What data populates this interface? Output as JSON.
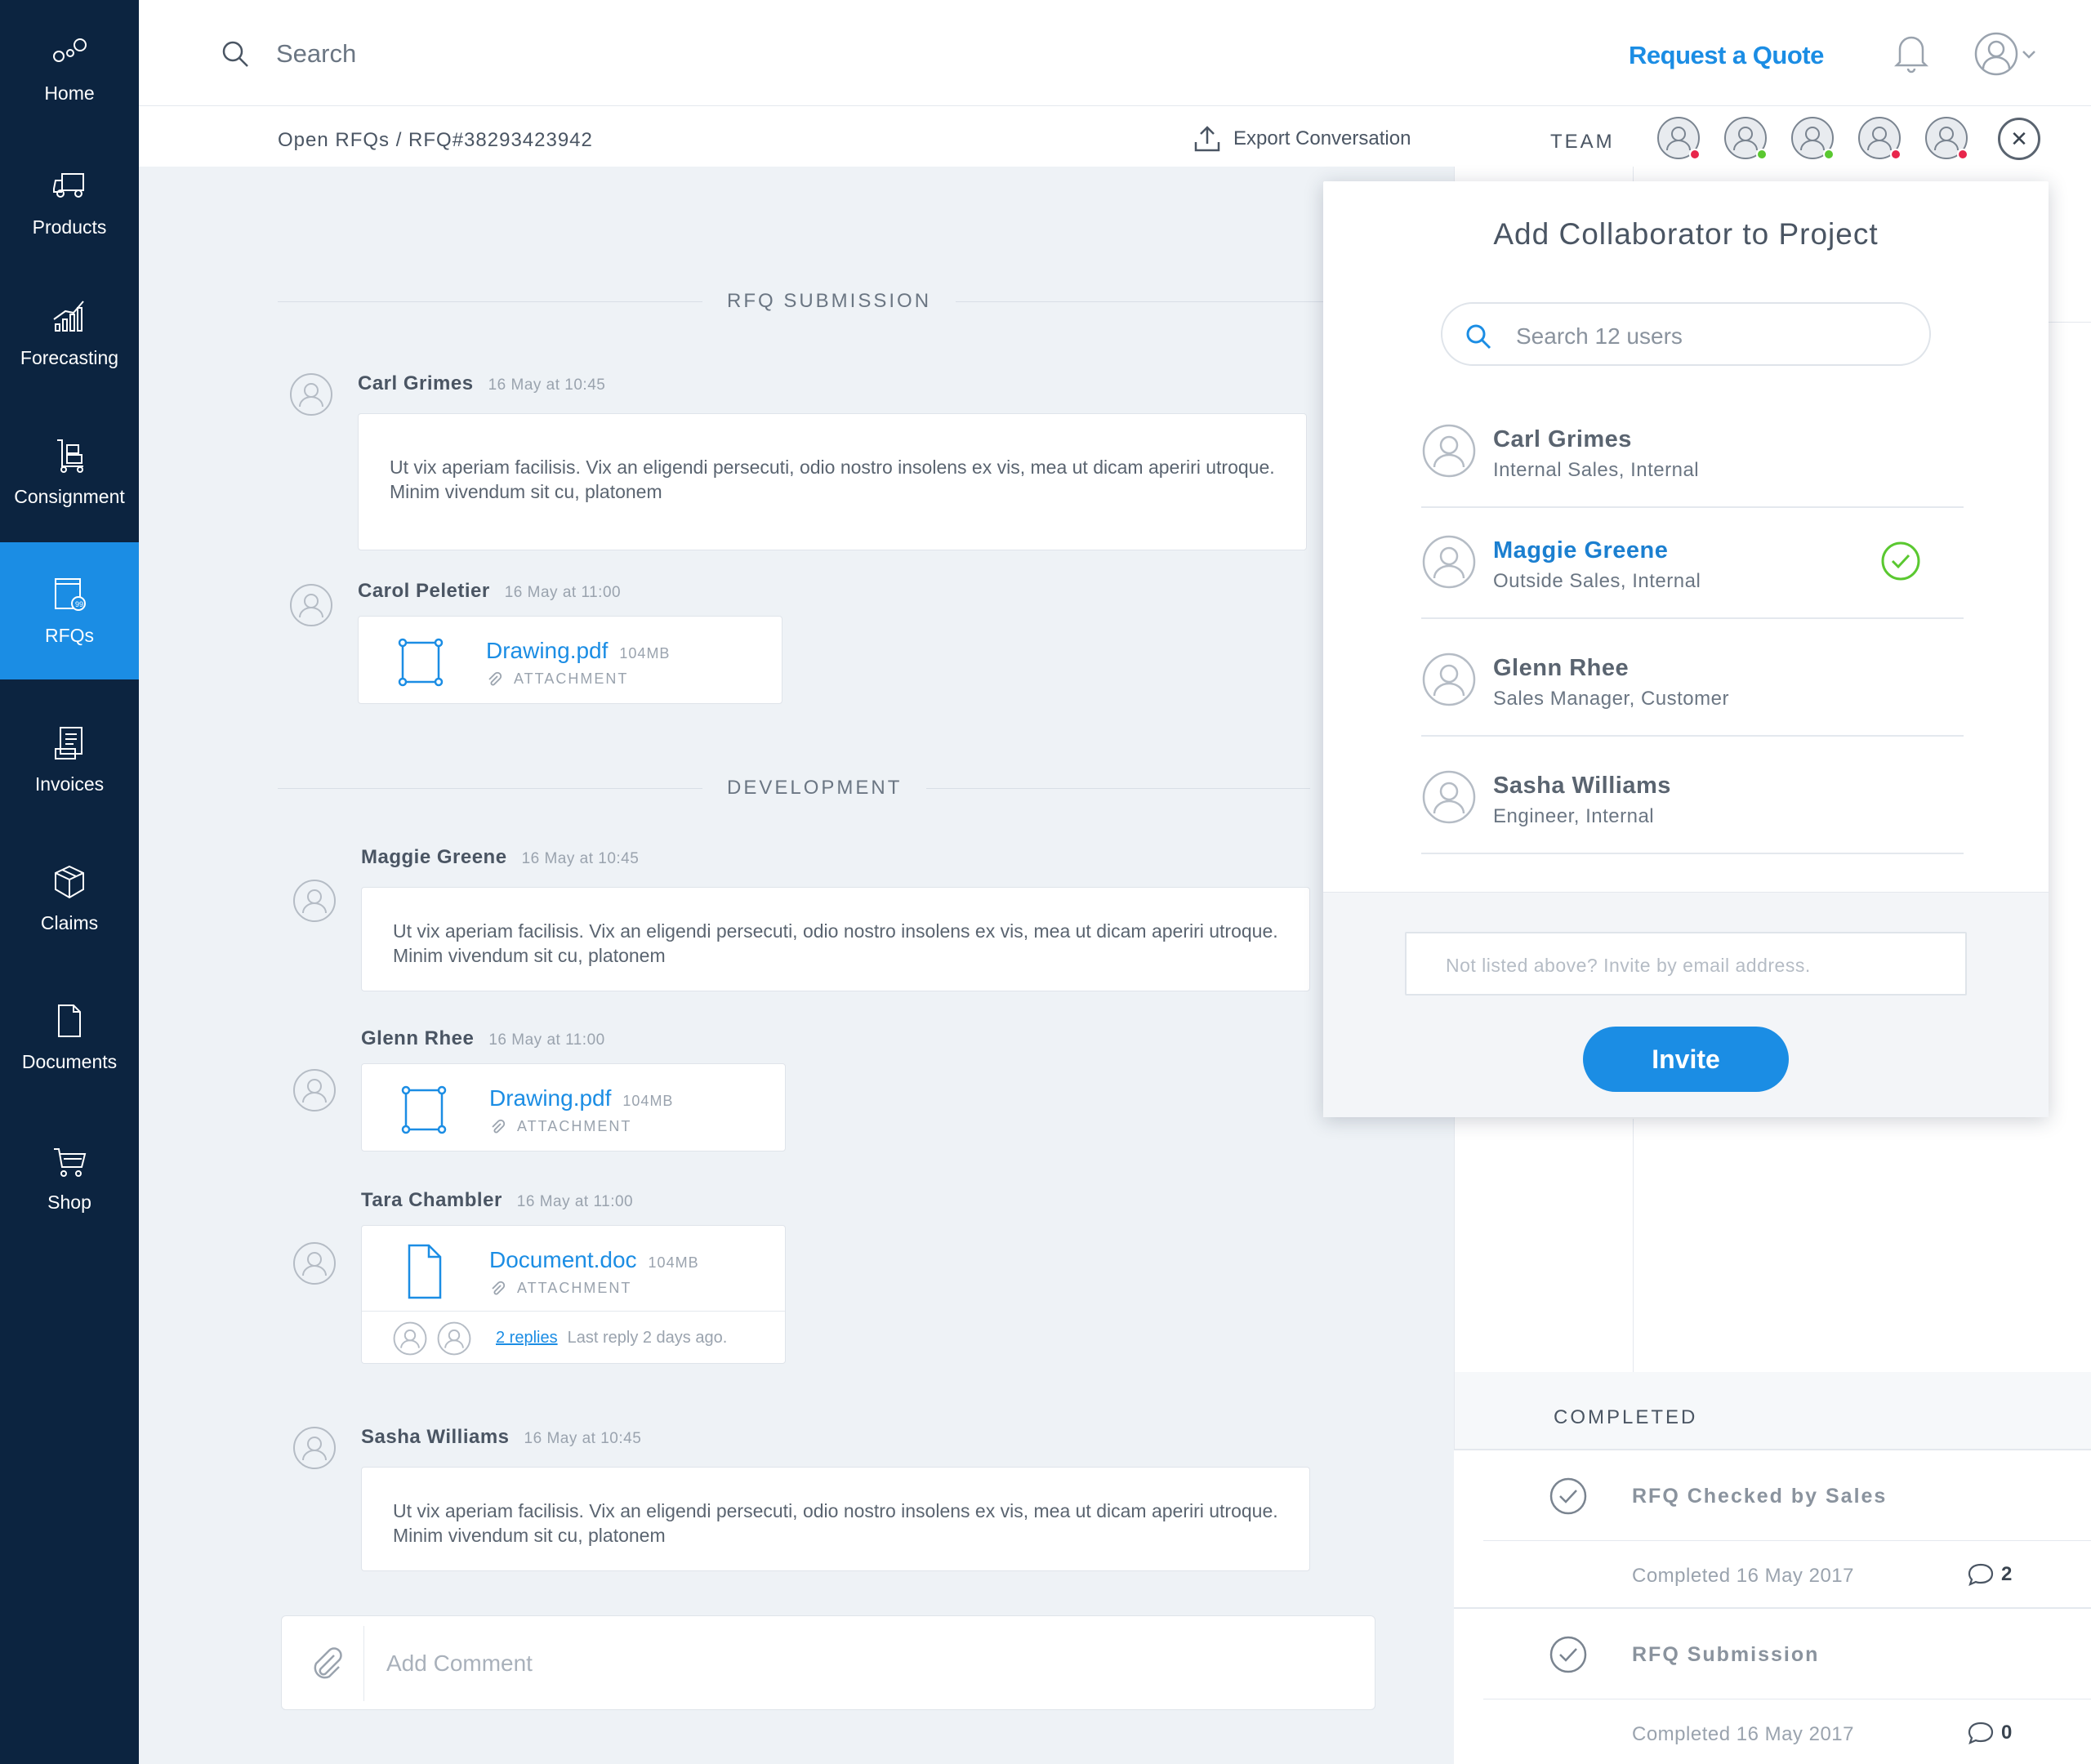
{
  "sidebar": {
    "items": [
      {
        "label": "Home",
        "icon": "home-icon"
      },
      {
        "label": "Products",
        "icon": "truck-icon"
      },
      {
        "label": "Forecasting",
        "icon": "chart-icon"
      },
      {
        "label": "Consignment",
        "icon": "cart-dolly-icon"
      },
      {
        "label": "RFQs",
        "icon": "rfq-icon",
        "active": true
      },
      {
        "label": "Invoices",
        "icon": "invoice-icon"
      },
      {
        "label": "Claims",
        "icon": "box-icon"
      },
      {
        "label": "Documents",
        "icon": "document-icon"
      },
      {
        "label": "Shop",
        "icon": "shop-cart-icon"
      }
    ]
  },
  "topbar": {
    "search_placeholder": "Search",
    "request_quote": "Request a Quote"
  },
  "subbar": {
    "breadcrumb": "Open RFQs / RFQ#38293423942",
    "export_label": "Export Conversation",
    "team_label": "TEAM",
    "team_status": [
      "red",
      "green",
      "green",
      "red",
      "red"
    ],
    "close_symbol": "✕"
  },
  "colors": {
    "accent": "#1b8de4",
    "sidebar_bg": "#0c2440",
    "status_red": "#e8264b",
    "status_green": "#5ac830",
    "check_green": "#5ac830"
  },
  "conversation": {
    "section1": "RFQ SUBMISSION",
    "section2": "DEVELOPMENT",
    "messages": [
      {
        "author": "Carl Grimes",
        "time": "16 May at 10:45",
        "text": "Ut vix aperiam facilisis. Vix an eligendi persecuti, odio nostro insolens ex vis, mea ut dicam aperiri utroque. Minim vivendum sit cu, platonem"
      },
      {
        "author": "Carol Peletier",
        "time": "16 May at 11:00",
        "file": "Drawing.pdf",
        "size": "104MB",
        "label": "ATTACHMENT"
      },
      {
        "author": "Maggie Greene",
        "time": "16 May at 10:45",
        "text": "Ut vix aperiam facilisis. Vix an eligendi persecuti, odio nostro insolens ex vis, mea ut dicam aperiri utroque. Minim vivendum sit cu, platonem"
      },
      {
        "author": "Glenn Rhee",
        "time": "16 May at 11:00",
        "file": "Drawing.pdf",
        "size": "104MB",
        "label": "ATTACHMENT"
      },
      {
        "author": "Tara Chambler",
        "time": "16 May at 11:00",
        "file": "Document.doc",
        "size": "104MB",
        "label": "ATTACHMENT",
        "replies": "2 replies",
        "last_reply": "Last reply 2 days ago."
      },
      {
        "author": "Sasha Williams",
        "time": "16 May at 10:45",
        "text": "Ut vix aperiam facilisis. Vix an eligendi persecuti, odio nostro insolens ex vis, mea ut dicam aperiri utroque. Minim vivendum sit cu, platonem"
      }
    ],
    "comment_placeholder": "Add Comment"
  },
  "right_panel": {
    "completed_title": "COMPLETED",
    "items": [
      {
        "title": "RFQ Checked by Sales",
        "date": "Completed 16 May 2017",
        "count": "2"
      },
      {
        "title": "RFQ Submission",
        "date": "Completed 16 May 2017",
        "count": "0"
      }
    ]
  },
  "modal": {
    "title": "Add Collaborator to Project",
    "search_placeholder": "Search 12 users",
    "users": [
      {
        "name": "Carl Grimes",
        "role": "Internal Sales, Internal",
        "selected": false
      },
      {
        "name": "Maggie Greene",
        "role": "Outside Sales, Internal",
        "selected": true
      },
      {
        "name": "Glenn Rhee",
        "role": "Sales Manager, Customer",
        "selected": false
      },
      {
        "name": "Sasha Williams",
        "role": "Engineer, Internal",
        "selected": false
      }
    ],
    "email_placeholder": "Not listed above? Invite by email address.",
    "invite_label": "Invite"
  }
}
